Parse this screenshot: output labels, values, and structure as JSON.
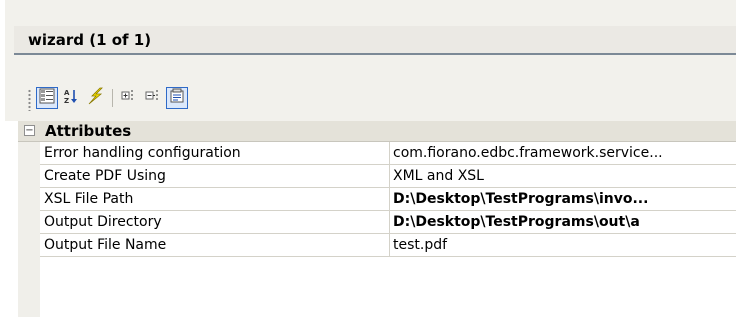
{
  "window": {
    "title": "wizard (1 of 1)"
  },
  "toolbar": {
    "buttons": [
      {
        "name": "categorized-view-icon",
        "active": true
      },
      {
        "name": "sort-alphabetical-icon",
        "active": false
      },
      {
        "name": "lightning-events-icon",
        "active": false
      },
      {
        "name": "expand-all-icon",
        "active": false
      },
      {
        "name": "collapse-all-icon",
        "active": false
      },
      {
        "name": "property-pages-icon",
        "active": true
      }
    ]
  },
  "grid": {
    "category": {
      "toggle": "−",
      "label": "Attributes"
    },
    "properties": [
      {
        "name": "Error handling configuration",
        "value": "com.fiorano.edbc.framework.service...",
        "bold": false
      },
      {
        "name": "Create PDF Using",
        "value": "XML and XSL",
        "bold": false
      },
      {
        "name": "XSL File Path",
        "value": "D:\\Desktop\\TestPrograms\\invo...",
        "bold": true
      },
      {
        "name": "Output Directory",
        "value": "D:\\Desktop\\TestPrograms\\out\\a",
        "bold": true
      },
      {
        "name": "Output File Name",
        "value": "test.pdf",
        "bold": false
      }
    ]
  },
  "colors": {
    "accent": "#2f6ac7",
    "header_bg": "#e4e2d9",
    "panel_bg": "#f2f1ec"
  }
}
